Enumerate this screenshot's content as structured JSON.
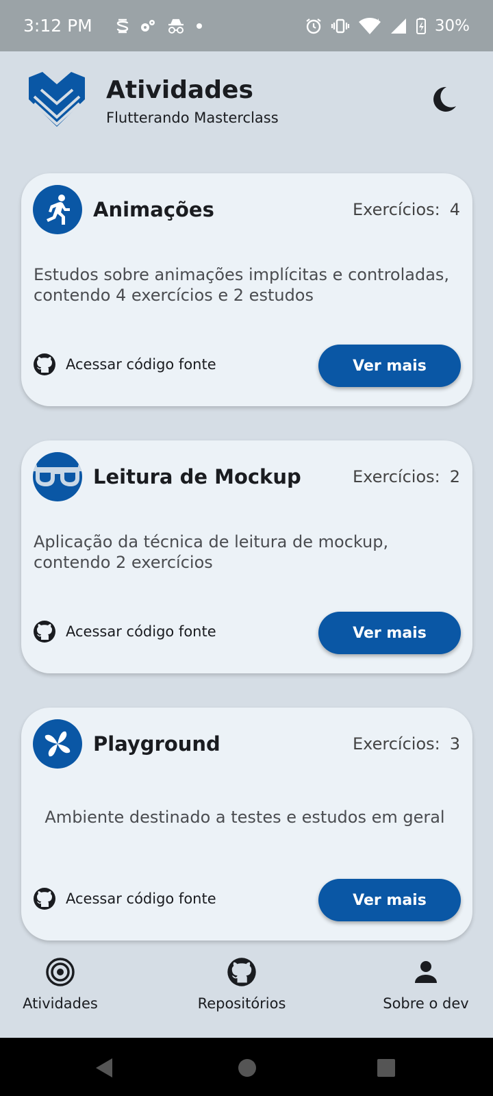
{
  "status_bar": {
    "time": "3:12 PM",
    "battery": "30%",
    "icons": [
      "s-icon",
      "settings-icon",
      "incognito-icon",
      "dot-icon",
      "alarm-icon",
      "vibrate-icon",
      "wifi-icon",
      "signal-icon",
      "battery-icon"
    ]
  },
  "header": {
    "title": "Atividades",
    "subtitle": "Flutterando Masterclass",
    "theme_icon": "moon-icon",
    "logo_color": "#0a57a5"
  },
  "cards": [
    {
      "icon": "running-icon",
      "title": "Animações",
      "count_label": "Exercícios:",
      "count": "4",
      "description": "Estudos sobre animações implícitas e controladas, contendo 4 exercícios e 2 estudos",
      "source_label": "Acessar código fonte",
      "button_label": "Ver mais"
    },
    {
      "icon": "glasses-icon",
      "title": "Leitura de Mockup",
      "count_label": "Exercícios:",
      "count": "2",
      "description": "Aplicação da técnica de leitura de mockup, contendo 2 exercícios",
      "source_label": "Acessar código fonte",
      "button_label": "Ver mais"
    },
    {
      "icon": "pinwheel-icon",
      "title": "Playground",
      "count_label": "Exercícios:",
      "count": "3",
      "description": "Ambiente destinado a testes e estudos em geral",
      "source_label": "Acessar código fonte",
      "button_label": "Ver mais"
    }
  ],
  "bottom_nav": [
    {
      "icon": "target-icon",
      "label": "Atividades"
    },
    {
      "icon": "github-icon",
      "label": "Repositórios"
    },
    {
      "icon": "person-icon",
      "label": "Sobre o dev"
    }
  ],
  "colors": {
    "accent": "#0a57a5",
    "background": "#d5dde5",
    "card": "#ecf2f7"
  }
}
